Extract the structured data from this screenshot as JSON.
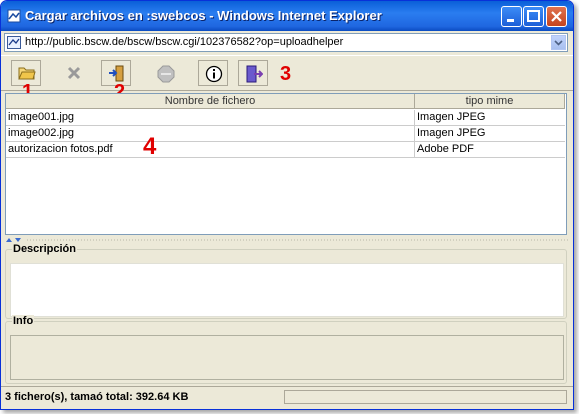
{
  "window": {
    "title": "Cargar archivos en :swebcos - Windows Internet Explorer",
    "address": "http://public.bscw.de/bscw/bscw.cgi/102376582?op=uploadhelper"
  },
  "toolbar": {
    "buttons": [
      {
        "name": "open-folder-icon",
        "enabled": true
      },
      {
        "name": "delete-icon",
        "enabled": false
      },
      {
        "name": "upload-icon",
        "enabled": true
      },
      {
        "name": "stop-icon",
        "enabled": false
      },
      {
        "name": "info-icon",
        "enabled": true
      },
      {
        "name": "exit-icon",
        "enabled": true
      }
    ]
  },
  "callouts": [
    "1",
    "2",
    "3",
    "4"
  ],
  "table": {
    "columns": [
      "Nombre de fichero",
      "tipo mime"
    ],
    "rows": [
      [
        "image001.jpg",
        "Imagen JPEG"
      ],
      [
        "image002.jpg",
        "Imagen JPEG"
      ],
      [
        "autorizacion fotos.pdf",
        "Adobe PDF"
      ]
    ]
  },
  "description": {
    "label": "Descripción"
  },
  "info": {
    "label": "Info"
  },
  "status": {
    "text": "3 fichero(s), tamaó total: 392.64 KB"
  }
}
